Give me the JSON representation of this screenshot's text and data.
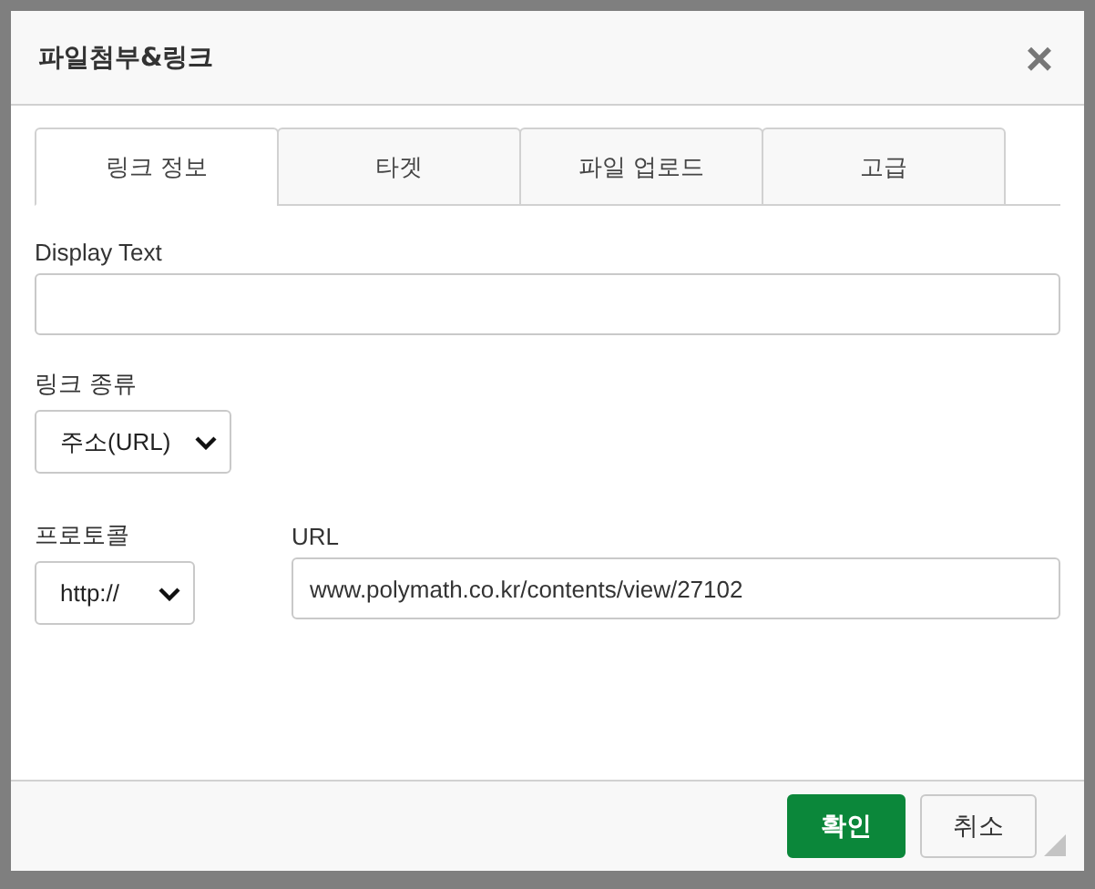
{
  "dialog": {
    "title": "파일첨부&링크",
    "close": "×"
  },
  "tabs": [
    {
      "label": "링크 정보",
      "selected": true
    },
    {
      "label": "타겟",
      "selected": false
    },
    {
      "label": "파일 업로드",
      "selected": false
    },
    {
      "label": "고급",
      "selected": false
    }
  ],
  "display_text": {
    "label": "Display Text"
  },
  "link_type": {
    "label": "링크 종류",
    "value": "주소(URL)"
  },
  "protocol": {
    "label": "프로토콜",
    "value": "http://"
  },
  "url": {
    "label": "URL",
    "value": "www.polymath.co.kr/contents/view/27102"
  },
  "buttons": [
    {
      "label": "확인",
      "kind": "primary"
    },
    {
      "label": "취소",
      "kind": "secondary"
    }
  ]
}
